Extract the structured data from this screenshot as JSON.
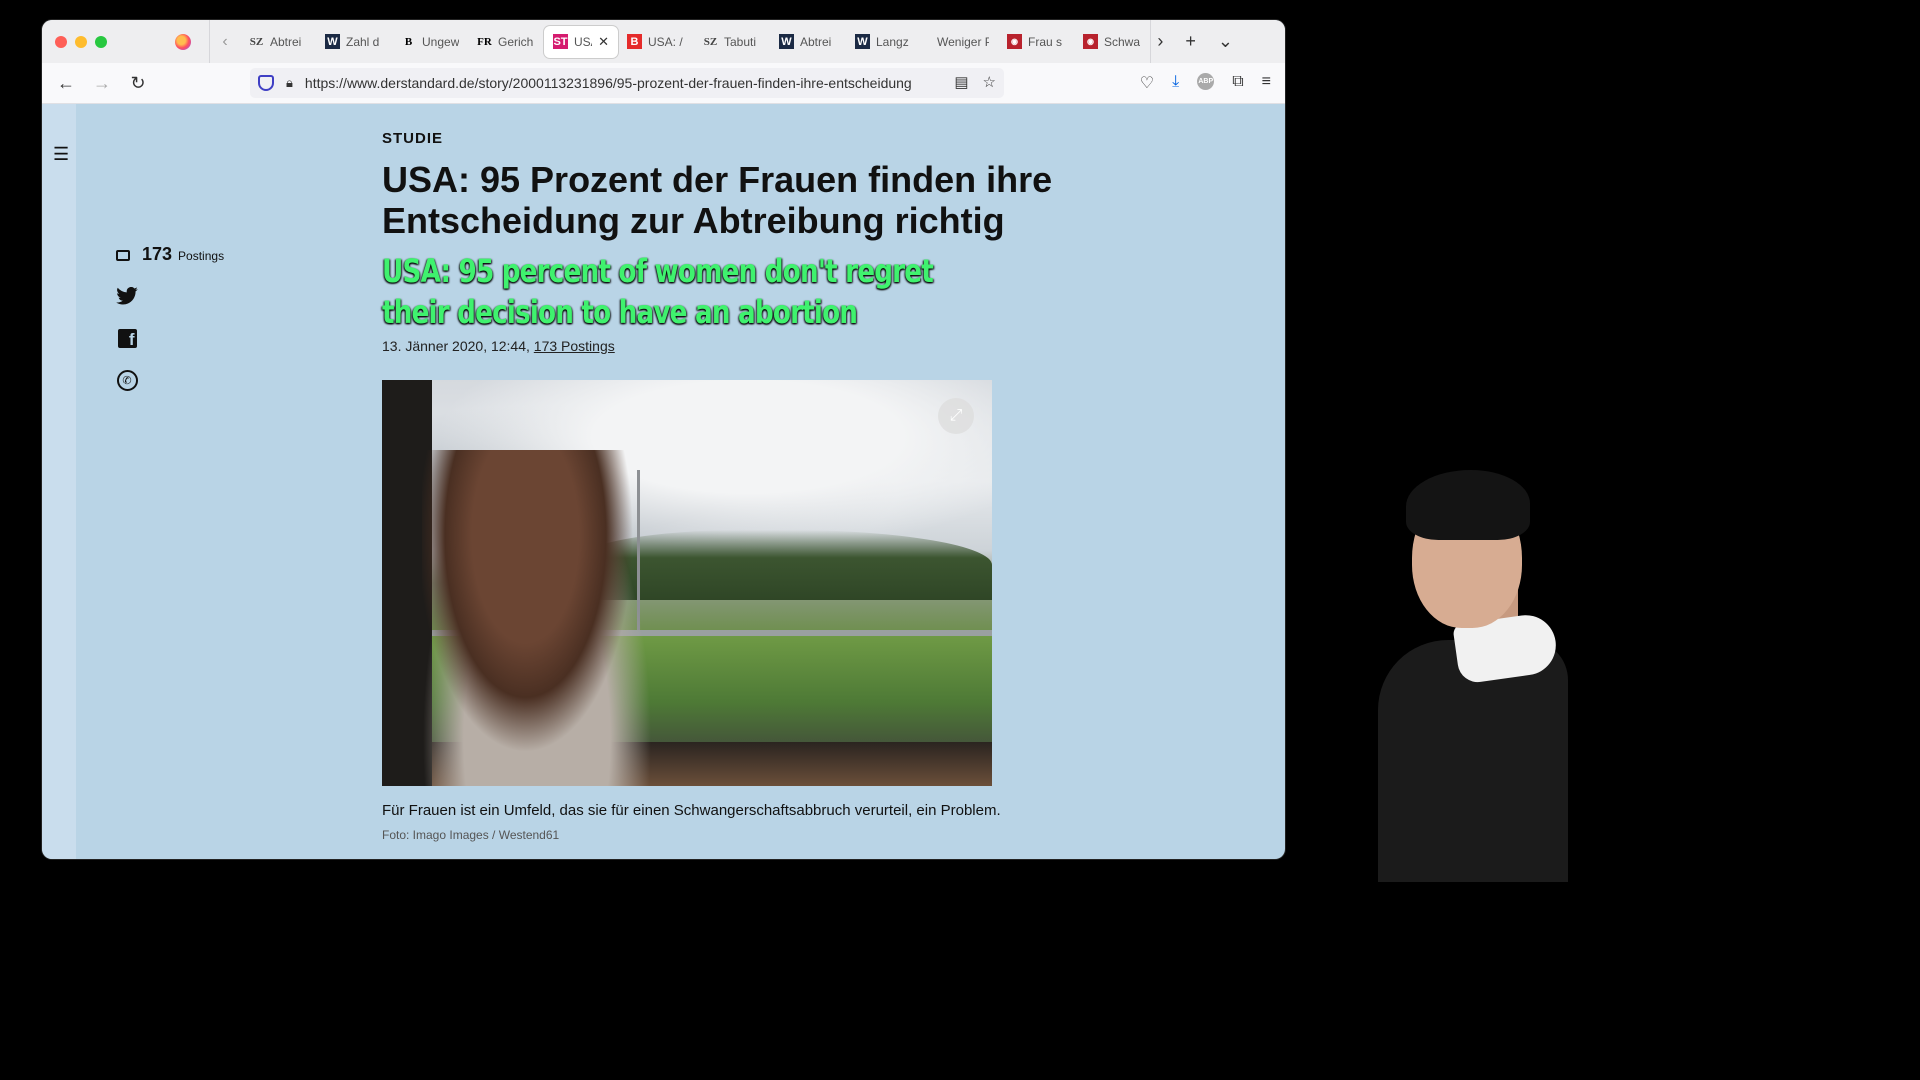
{
  "browser": {
    "tabs": [
      {
        "favicon": "SZ",
        "kind": "sz",
        "label": "Abtrei"
      },
      {
        "favicon": "W",
        "kind": "w",
        "label": "Zahl d"
      },
      {
        "favicon": "B",
        "kind": "fr",
        "label": "Ungew"
      },
      {
        "favicon": "FR",
        "kind": "fr",
        "label": "Gerich"
      },
      {
        "favicon": "ST",
        "kind": "st",
        "label": "USA: /"
      },
      {
        "favicon": "B",
        "kind": "b",
        "label": "USA: /"
      },
      {
        "favicon": "SZ",
        "kind": "sz",
        "label": "Tabuti"
      },
      {
        "favicon": "W",
        "kind": "w",
        "label": "Abtrei"
      },
      {
        "favicon": "W",
        "kind": "w",
        "label": "Langz"
      },
      {
        "favicon": "",
        "kind": "none",
        "label": "Weniger P"
      },
      {
        "favicon": "◉",
        "kind": "pic",
        "label": "Frau s"
      },
      {
        "favicon": "◉",
        "kind": "pic",
        "label": "Schwa"
      }
    ],
    "active_tab_index": 4,
    "url": "https://www.derstandard.de/story/2000113231896/95-prozent-der-frauen-finden-ihre-entscheidung"
  },
  "article": {
    "kicker": "STUDIE",
    "headline_line1": "USA: 95 Prozent der Frauen finden ihre",
    "headline_line2": "Entscheidung zur Abtreibung richtig",
    "translation_line1": "USA: 95 percent of women don't regret",
    "translation_line2": "their decision to have an abortion",
    "date": "13. Jänner 2020, 12:44,",
    "postings_link": "173 Postings",
    "caption": "Für Frauen ist ein Umfeld, das sie für einen Schwangerschaftsabbruch verurteil, ein Problem.",
    "credit": "Foto: Imago Images / Westend61"
  },
  "share": {
    "postings_count": "173",
    "postings_label": "Postings"
  },
  "colors": {
    "page_bg": "#b9d4e6",
    "translation": "#3ff26e"
  }
}
